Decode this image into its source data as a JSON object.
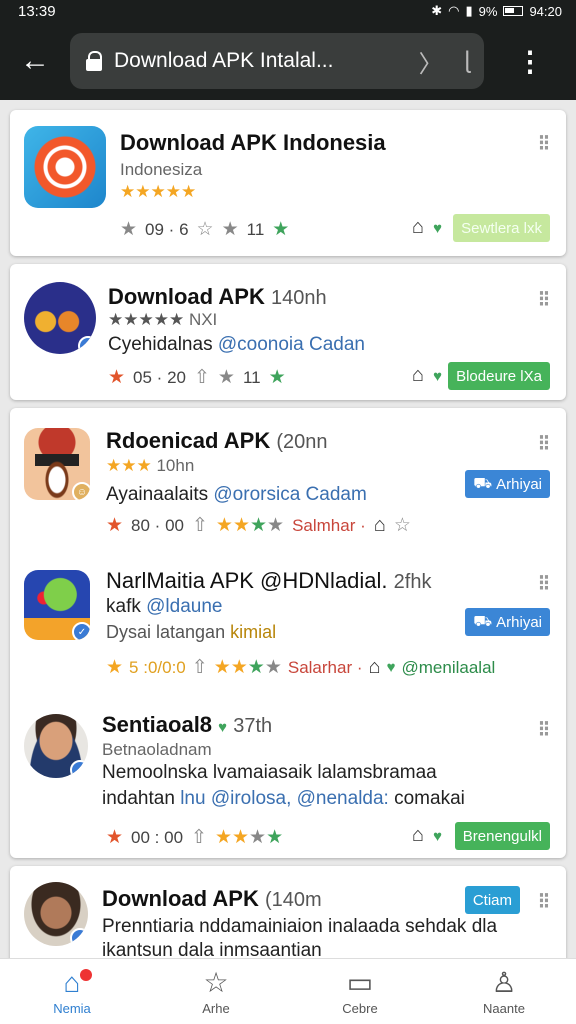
{
  "status": {
    "time": "13:39",
    "battery": "9%",
    "clock_right": "94:20"
  },
  "browser": {
    "url": "Download APK Intalal..."
  },
  "colors": {
    "accent": "#2f7fd0",
    "green": "#46b35a",
    "blue": "#3b86d6"
  },
  "posts": [
    {
      "title": "Download APK Indonesia",
      "sub": "Indonesiza",
      "stars": "★★★★★",
      "meta_a": "09 · 6",
      "meta_b": "11",
      "badge": "Sewtlera lxk"
    },
    {
      "title": "Download APK",
      "time": "140nh",
      "stars": "★★★★★",
      "stars_note": "NXI",
      "desc_a": "Cyehidalnas",
      "desc_link": "@coonoia Cadan",
      "meta_a": "05 · 20",
      "meta_b": "11",
      "badge": "Blodeure lXa"
    },
    {
      "title": "Rdoenicad APK",
      "time": "(20nn",
      "stars": "★★★",
      "stars_note": "10hn",
      "desc_a": "Ayainaalaits",
      "desc_link": "@ororsica Cadam",
      "meta_a": "80 · 00",
      "meta_label": "Salmhar ·",
      "badge": "Arhiyai"
    },
    {
      "title": "NarlMaitia APK @HDNladial.",
      "time": "2fhk",
      "sub_a": "kafk",
      "sub_link": "@ldaune",
      "desc_a": "Dysai latangan",
      "desc_b": "kimial",
      "meta_a": "5 :0/0:0",
      "meta_label": "Salarhar ·",
      "meta_link": "@menilaalal",
      "badge": "Arhiyai"
    },
    {
      "title": "Sentiaoal8",
      "time": "37th",
      "sub": "Betnaoladnam",
      "desc_line1": "Nemoolnska lvamaiasaik lalamsbramaa",
      "desc_line2_a": "indahtan",
      "desc_line2_link": "lnu @irolosa, @nenalda:",
      "desc_line2_b": "comakai",
      "meta_a": "00 : 00",
      "badge": "Brenengulkl"
    },
    {
      "title": "Download APK",
      "time": "(140m",
      "desc_line1": "Prenntiaria nddamainiaion inalaada sehdak dla",
      "desc_line2": "ikantsun dala inmsaantian",
      "badge": "Ctiam"
    }
  ],
  "bottom_nav": [
    {
      "label": "Nemia",
      "icon": "home-icon"
    },
    {
      "label": "Arhe",
      "icon": "star-icon"
    },
    {
      "label": "Cebre",
      "icon": "cart-icon"
    },
    {
      "label": "Naante",
      "icon": "profile-icon"
    }
  ]
}
